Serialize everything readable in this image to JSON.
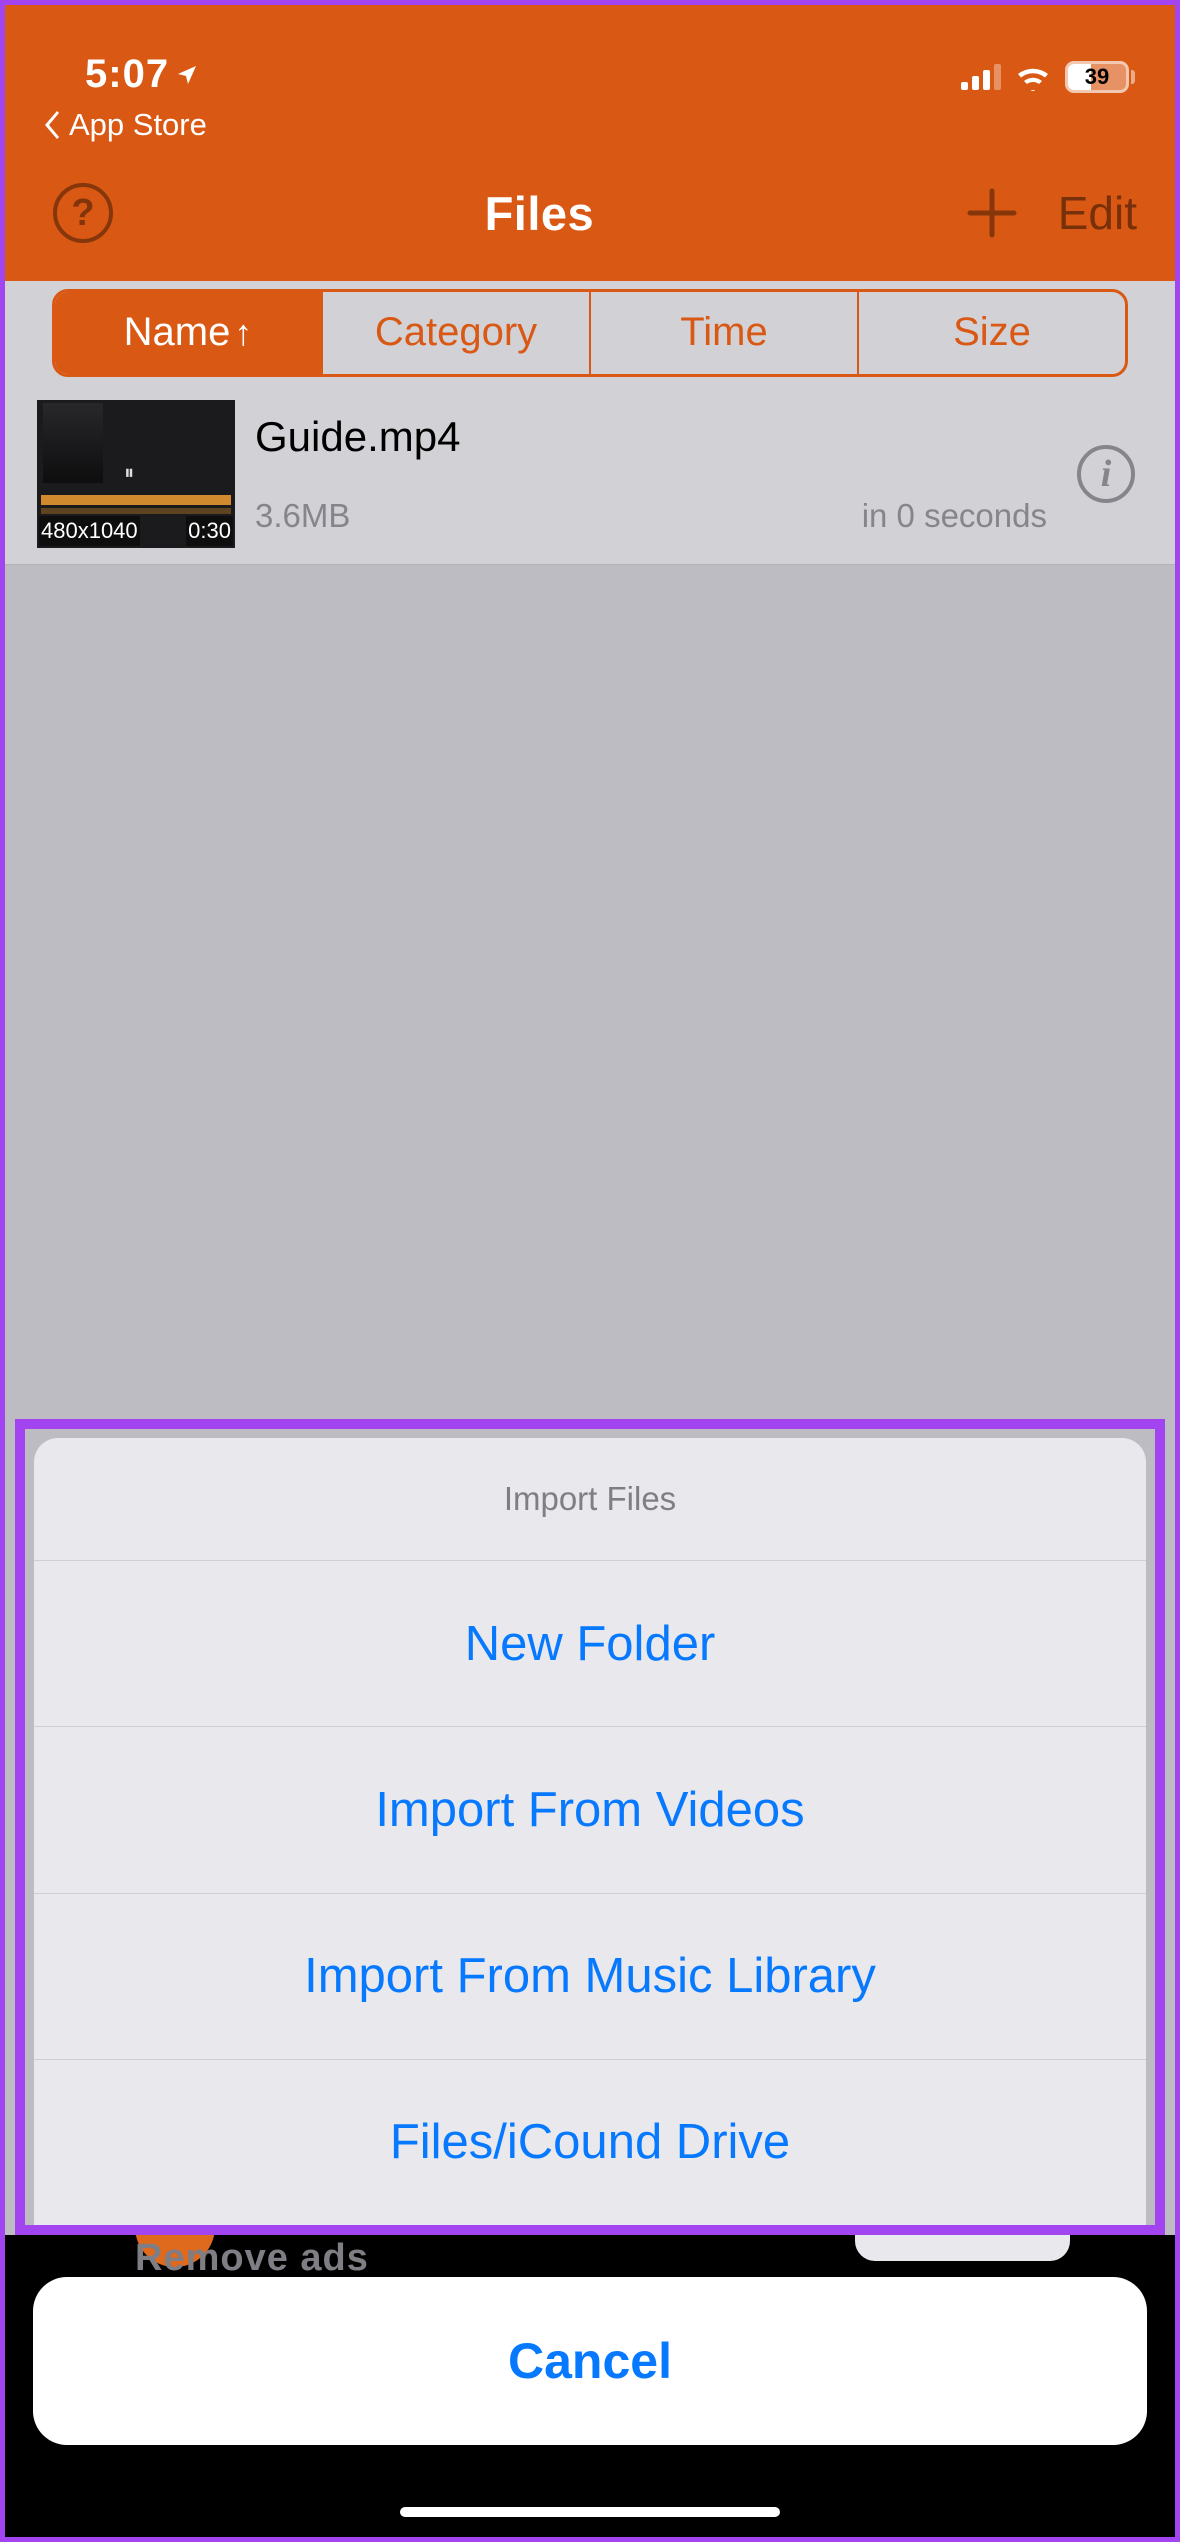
{
  "status": {
    "time": "5:07",
    "back_breadcrumb": "App Store",
    "battery_pct": "39"
  },
  "nav": {
    "title": "Files",
    "help_glyph": "?",
    "edit_label": "Edit"
  },
  "segments": {
    "name": "Name",
    "name_arrow": "↑",
    "category": "Category",
    "time": "Time",
    "size": "Size"
  },
  "file": {
    "name": "Guide.mp4",
    "size": "3.6MB",
    "age": "in 0 seconds",
    "resolution": "480x1040",
    "duration": "0:30"
  },
  "sheet": {
    "title": "Import Files",
    "items": {
      "new_folder": "New Folder",
      "import_videos": "Import From Videos",
      "import_music": "Import From Music Library",
      "files_icloud": "Files/iCound Drive"
    },
    "cancel": "Cancel"
  },
  "footer": {
    "remove_ads_partial": "Remove ads"
  }
}
